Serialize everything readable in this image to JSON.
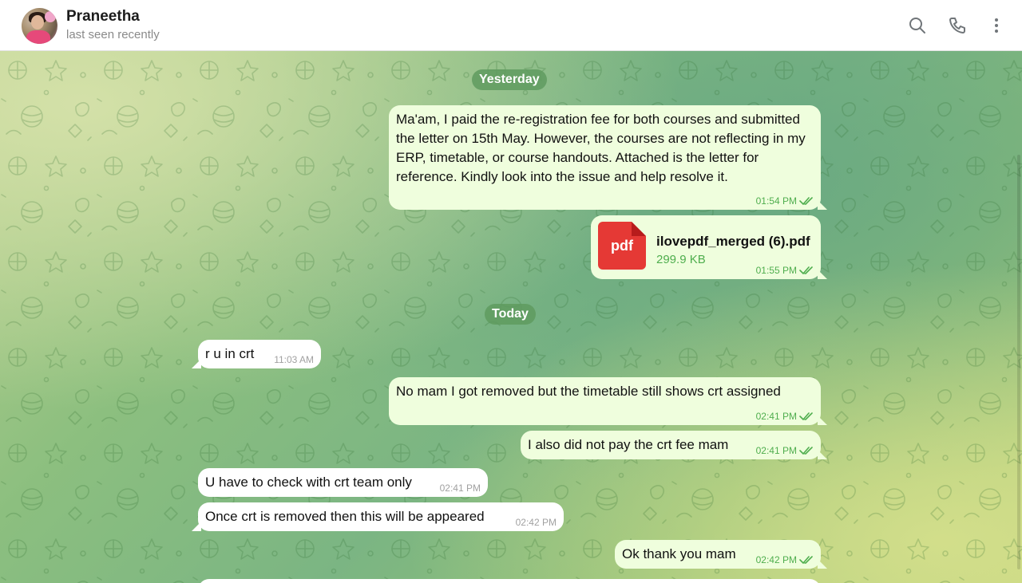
{
  "header": {
    "name": "Praneetha",
    "status": "last seen recently",
    "search_icon": "search-icon",
    "call_icon": "phone-icon",
    "menu_icon": "more-vertical-icon"
  },
  "dates": {
    "yesterday": "Yesterday",
    "today": "Today"
  },
  "messages": [
    {
      "dir": "out",
      "text": "Ma'am, I paid the re-registration fee for both courses and submitted the letter on 15th May. However, the courses are not reflecting in my ERP, timetable, or course handouts. Attached is the letter for reference. Kindly look into the issue and help resolve it.",
      "time": "01:54 PM"
    },
    {
      "dir": "out",
      "type": "file",
      "icon_text": "pdf",
      "file_name": "ilovepdf_merged (6).pdf",
      "file_size": "299.9 KB",
      "time": "01:55 PM"
    },
    {
      "dir": "in",
      "text": "r u in crt",
      "time": "11:03 AM"
    },
    {
      "dir": "out",
      "text": "No mam I got removed but the timetable still shows crt assigned",
      "time": "02:41 PM"
    },
    {
      "dir": "out",
      "text": "I also did not pay the crt fee mam",
      "time": "02:41 PM"
    },
    {
      "dir": "in",
      "text": "U have to check with crt team only",
      "time": "02:41 PM"
    },
    {
      "dir": "in",
      "text": "Once crt is removed then this will be appeared",
      "time": "02:42 PM"
    },
    {
      "dir": "out",
      "text": "Ok thank you mam",
      "time": "02:42 PM"
    }
  ],
  "colors": {
    "outgoing_bubble": "#effedd",
    "incoming_bubble": "#ffffff",
    "accent_green": "#4fae4e",
    "pdf_red": "#e53935"
  }
}
